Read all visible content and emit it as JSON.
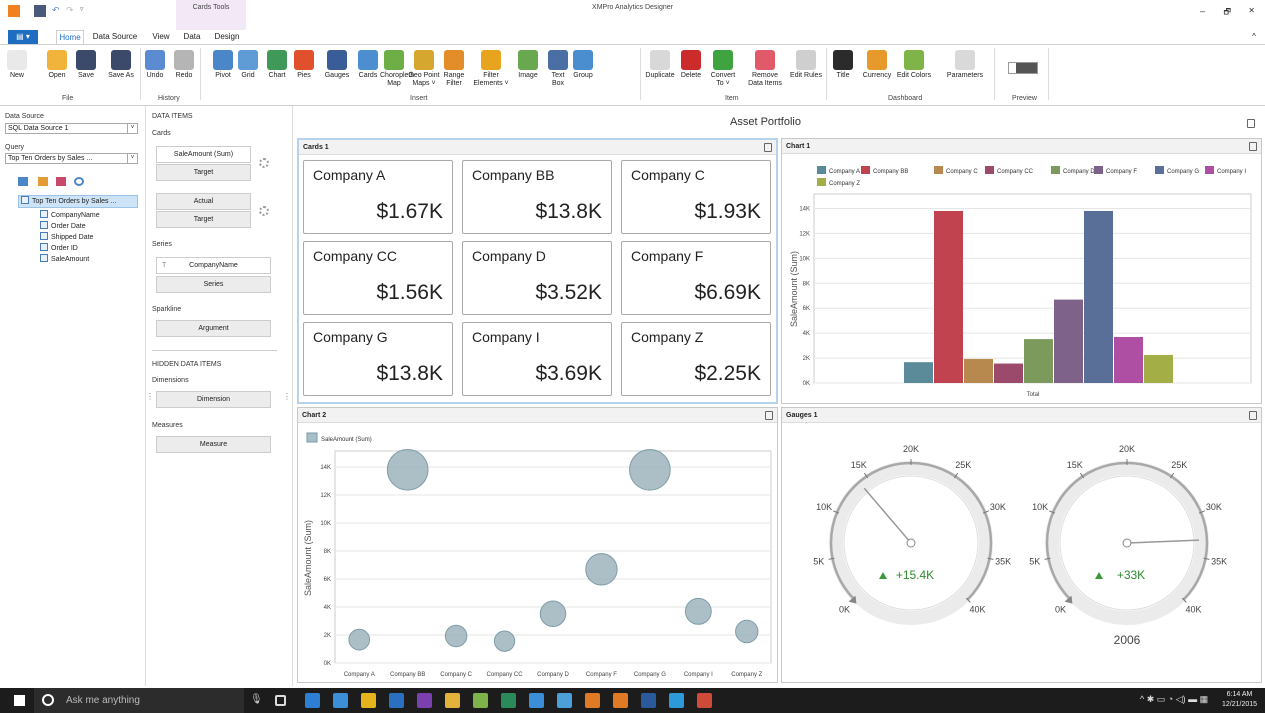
{
  "window": {
    "title": "XMPro Analytics Designer",
    "context_tab": "Cards Tools",
    "controls": [
      "–",
      "🗗",
      "✕"
    ]
  },
  "tabs": [
    {
      "label": "Home"
    },
    {
      "label": "Data Source"
    },
    {
      "label": "View"
    },
    {
      "label": "Data"
    },
    {
      "label": "Design"
    }
  ],
  "ribbon": {
    "buttons": [
      {
        "label": "New",
        "color": "#e9e9e9"
      },
      {
        "label": "Open",
        "color": "#f0b43c"
      },
      {
        "label": "Save",
        "color": "#3b4a6b"
      },
      {
        "label": "Save As",
        "color": "#3b4a6b"
      },
      {
        "label": "Undo",
        "color": "#5b8bd0"
      },
      {
        "label": "Redo",
        "color": "#b5b5b5"
      },
      {
        "label": "Pivot",
        "color": "#4a86c8"
      },
      {
        "label": "Grid",
        "color": "#5f9bd5"
      },
      {
        "label": "Chart",
        "color": "#3f9a5a"
      },
      {
        "label": "Pies",
        "color": "#e0502d"
      },
      {
        "label": "Gauges",
        "color": "#3a5d9a"
      },
      {
        "label": "Cards",
        "color": "#4b8fd1"
      },
      {
        "label": "Choropleth Map",
        "color": "#6fae47"
      },
      {
        "label": "Geo Point Maps ˅",
        "color": "#d6a72e"
      },
      {
        "label": "Range Filter",
        "color": "#e28c2a"
      },
      {
        "label": "Filter Elements ˅",
        "color": "#e8a41f"
      },
      {
        "label": "Image",
        "color": "#69a84f"
      },
      {
        "label": "Text Box",
        "color": "#4a6fa5"
      },
      {
        "label": "Group",
        "color": "#4a8ed0"
      },
      {
        "label": "Duplicate",
        "color": "#d8d8d8"
      },
      {
        "label": "Delete",
        "color": "#cc2b2b"
      },
      {
        "label": "Convert To ˅",
        "color": "#3fa33f"
      },
      {
        "label": "Remove Data Items",
        "color": "#e05a6a"
      },
      {
        "label": "Edit Rules",
        "color": "#cfcfcf"
      },
      {
        "label": "Title",
        "color": "#2b2b2b"
      },
      {
        "label": "Currency",
        "color": "#e59a2b"
      },
      {
        "label": "Edit Colors",
        "color": "#7fb548"
      },
      {
        "label": "Parameters",
        "color": "#d9d9d9"
      }
    ],
    "groups": [
      "File",
      "History",
      "Insert",
      "Item",
      "Dashboard",
      "Preview"
    ]
  },
  "left": {
    "data_source_label": "Data Source",
    "data_source_value": "SQL Data Source 1",
    "query_label": "Query",
    "query_value": "Top Ten Orders by Sales ...",
    "tree_root": "Top Ten Orders by Sales ...",
    "fields": [
      "CompanyName",
      "Order Date",
      "Shipped Date",
      "Order ID",
      "SaleAmount"
    ]
  },
  "items": {
    "header": "DATA ITEMS",
    "cards_label": "Cards",
    "slot1": "SaleAmount (Sum)",
    "slot1_target": "Target",
    "slot2": "Actual",
    "slot2_target": "Target",
    "series_label": "Series",
    "series_field": "CompanyName",
    "series_btn": "Series",
    "sparkline_label": "Sparkline",
    "argument_btn": "Argument",
    "hidden_header": "HIDDEN DATA ITEMS",
    "dimensions_label": "Dimensions",
    "dimension_btn": "Dimension",
    "measures_label": "Measures",
    "measure_btn": "Measure"
  },
  "dashboard_title": "Asset Portfolio",
  "cards_panel": {
    "title": "Cards 1",
    "cards": [
      {
        "name": "Company A",
        "value": "$1.67K"
      },
      {
        "name": "Company BB",
        "value": "$13.8K"
      },
      {
        "name": "Company C",
        "value": "$1.93K"
      },
      {
        "name": "Company CC",
        "value": "$1.56K"
      },
      {
        "name": "Company D",
        "value": "$3.52K"
      },
      {
        "name": "Company F",
        "value": "$6.69K"
      },
      {
        "name": "Company G",
        "value": "$13.8K"
      },
      {
        "name": "Company I",
        "value": "$3.69K"
      },
      {
        "name": "Company Z",
        "value": "$2.25K"
      }
    ]
  },
  "chart1_title": "Chart 1",
  "chart2_title": "Chart 2",
  "gauges_title": "Gauges 1",
  "chart_data": [
    {
      "type": "bar",
      "ylabel": "SaleAmount (Sum)",
      "xlabel": "Total",
      "ylim": [
        0,
        15000
      ],
      "yticks": [
        "0K",
        "2K",
        "4K",
        "6K",
        "8K",
        "10K",
        "12K",
        "14K"
      ],
      "series": [
        {
          "name": "Company A",
          "value": 1670,
          "color": "#5b8a99"
        },
        {
          "name": "Company BB",
          "value": 13800,
          "color": "#c0434f"
        },
        {
          "name": "Company C",
          "value": 1930,
          "color": "#b8894e"
        },
        {
          "name": "Company CC",
          "value": 1560,
          "color": "#9c4a6b"
        },
        {
          "name": "Company D",
          "value": 3520,
          "color": "#7b9a5b"
        },
        {
          "name": "Company F",
          "value": 6690,
          "color": "#7f6289"
        },
        {
          "name": "Company G",
          "value": 13800,
          "color": "#5a6f98"
        },
        {
          "name": "Company I",
          "value": 3690,
          "color": "#ae4fa4"
        },
        {
          "name": "Company Z",
          "value": 2250,
          "color": "#a3ae47"
        }
      ]
    },
    {
      "type": "scatter",
      "legend": "SaleAmount (Sum)",
      "ylabel": "SaleAmount (Sum)",
      "ylim": [
        0,
        15000
      ],
      "yticks": [
        "0K",
        "2K",
        "4K",
        "6K",
        "8K",
        "10K",
        "12K",
        "14K"
      ],
      "categories": [
        "Company A",
        "Company BB",
        "Company C",
        "Company CC",
        "Company D",
        "Company F",
        "Company G",
        "Company I",
        "Company Z"
      ],
      "values": [
        1670,
        13800,
        1930,
        1560,
        3520,
        6690,
        13800,
        3690,
        2250
      ]
    }
  ],
  "gauges": {
    "ticks": [
      "0K",
      "5K",
      "10K",
      "15K",
      "20K",
      "25K",
      "30K",
      "35K",
      "40K"
    ],
    "items": [
      {
        "value": 14000,
        "delta": "+15.4K",
        "caption": ""
      },
      {
        "value": 33000,
        "delta": "+33K",
        "caption": "2006"
      }
    ]
  },
  "taskbar": {
    "search": "Ask me anything",
    "time": "6:14 AM",
    "date": "12/21/2015"
  }
}
